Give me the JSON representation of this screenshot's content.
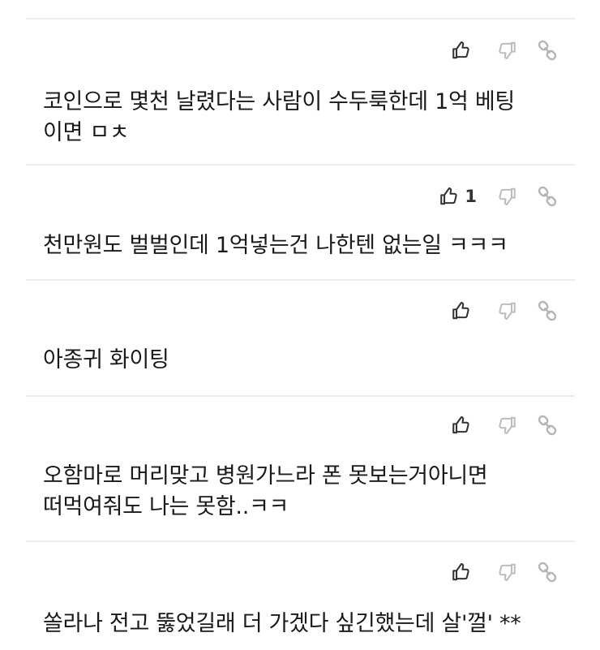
{
  "comments": [
    {
      "text": "코인으로 몇천 날렸다는 사람이 수두룩한데 1억 베팅\n이면 ㅁㅊ",
      "like_count": ""
    },
    {
      "text": "천만원도 벌벌인데 1억넣는건 나한텐 없는일 ㅋㅋㅋ",
      "like_count": "1"
    },
    {
      "text": "아종귀 화이팅",
      "like_count": ""
    },
    {
      "text": "오함마로 머리맞고 병원가느라 폰 못보는거아니면\n떠먹여줘도 나는 못함..ㅋㅋ",
      "like_count": ""
    },
    {
      "text": "쏠라나 전고 뚫었길래 더 가겠다 싶긴했는데 살'껄' **",
      "like_count": ""
    }
  ],
  "icons": {
    "like": "thumbs-up-icon",
    "dislike": "thumbs-down-icon",
    "share": "link-icon"
  },
  "colors": {
    "like_icon": "#333333",
    "dislike_icon": "#bdbdbd",
    "share_icon": "#b5b5b5",
    "divider": "#ececec",
    "text": "#1a1a1a"
  }
}
